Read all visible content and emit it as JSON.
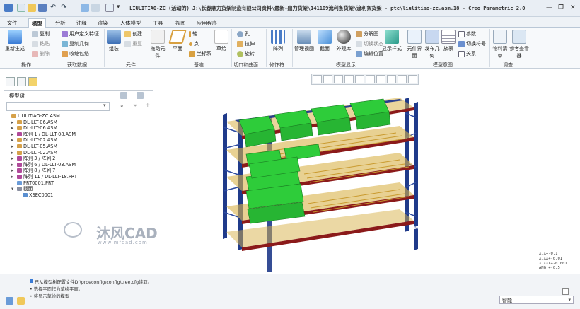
{
  "window": {
    "title": "LIULITIAO-ZC (活动的) J:\\长春鼎力货架制造有限公司资料\\最新-鼎力货架\\141109流利条货架\\流利条货架 - ptc\\liulitiao-zc.asm.18 - Creo Parametric 2.0"
  },
  "menu_tabs": [
    "文件",
    "模型",
    "分析",
    "注释",
    "渲染",
    "人体模型",
    "工具",
    "视图",
    "应用程序"
  ],
  "active_tab": "模型",
  "ribbon": {
    "groups": [
      "操作",
      "获取数据",
      "元件",
      "基准",
      "切口和曲面",
      "修饰符",
      "模型显示",
      "模型意图",
      "调查"
    ],
    "operations": {
      "regenerate": "重新生成",
      "copy": "复制",
      "paste": "粘贴",
      "delete": "删除"
    },
    "get_data": {
      "udf": "用户定义特征",
      "copy_geom": "复制几何",
      "shrinkwrap": "收缩包络"
    },
    "component": {
      "assemble": "组装",
      "create": "创建",
      "repeat": "重复",
      "drag": "拖动元件"
    },
    "datum": {
      "plane": "平面",
      "axis": "轴",
      "point": "点",
      "csys": "坐标系",
      "sketch": "草绘"
    },
    "cut_surface": {
      "hole": "孔",
      "extrude": "拉伸",
      "revolve": "旋转"
    },
    "modifiers": {
      "pattern": "阵列"
    },
    "display": {
      "manage_views": "管理视图",
      "section": "截面",
      "appearance": "外观库",
      "explode": "分解图",
      "toggle_state": "切换状态",
      "edit_position": "编辑位置",
      "display_style": "显示样式"
    },
    "intent": {
      "assembly_plane": "元件界面",
      "publish_geom": "发布几何",
      "family_table": "族表",
      "params": "参数",
      "switch_symbol": "切换符号",
      "relations": "关系"
    },
    "investigate": {
      "bom": "物料清单",
      "reference_viewer": "参考查看器"
    }
  },
  "tree": {
    "title": "模型树",
    "items": [
      {
        "label": "LIULITIAO-ZC.ASM",
        "indent": 0,
        "arrow": "",
        "kind": "asm"
      },
      {
        "label": "DL-LLT-06.ASM",
        "indent": 1,
        "arrow": "▸",
        "kind": "asm"
      },
      {
        "label": "DL-LLT-06.ASM",
        "indent": 1,
        "arrow": "▸",
        "kind": "asm"
      },
      {
        "label": "阵列 1 / DL-LLT-08.ASM",
        "indent": 1,
        "arrow": "▸",
        "kind": "pat"
      },
      {
        "label": "DL-LLT-02.ASM",
        "indent": 1,
        "arrow": "▸",
        "kind": "asm"
      },
      {
        "label": "DL-LLT-05.ASM",
        "indent": 1,
        "arrow": "▸",
        "kind": "asm"
      },
      {
        "label": "DL-LLT-02.ASM",
        "indent": 1,
        "arrow": "▸",
        "kind": "asm"
      },
      {
        "label": "阵列 3 / 阵列 2",
        "indent": 1,
        "arrow": "▸",
        "kind": "pat"
      },
      {
        "label": "阵列 6 / DL-LLT-03.ASM",
        "indent": 1,
        "arrow": "▸",
        "kind": "pat"
      },
      {
        "label": "阵列 8 / 阵列 7",
        "indent": 1,
        "arrow": "▸",
        "kind": "pat"
      },
      {
        "label": "阵列 11 / DL-LLT-18.PRT",
        "indent": 1,
        "arrow": "▸",
        "kind": "pat"
      },
      {
        "label": "PRT0001.PRT",
        "indent": 1,
        "arrow": "",
        "kind": "prt"
      },
      {
        "label": "截面",
        "indent": 1,
        "arrow": "▾",
        "kind": "sec"
      },
      {
        "label": "XSEC0001",
        "indent": 2,
        "arrow": "",
        "kind": "xsec"
      }
    ]
  },
  "messages": [
    "已从模型树配置文件D:\\proeconfig\\config\\tree.cfg读取。",
    "• 选择平面作为草绘平面。",
    "• 将显示草绘的模型"
  ],
  "selector_value": "智能",
  "coords": [
    "X.X+-0.1",
    "X.XX+-0.01",
    "X.XXX+-0.001",
    "ANG.+-0.5"
  ],
  "watermark": {
    "brand": "沐风CAD",
    "url": "www.mfcad.com"
  },
  "colors": {
    "upright": "#1f3a8a",
    "beam": "#8b1a1a",
    "bin": "#2ecc3a",
    "roller": "#d8b24a"
  }
}
